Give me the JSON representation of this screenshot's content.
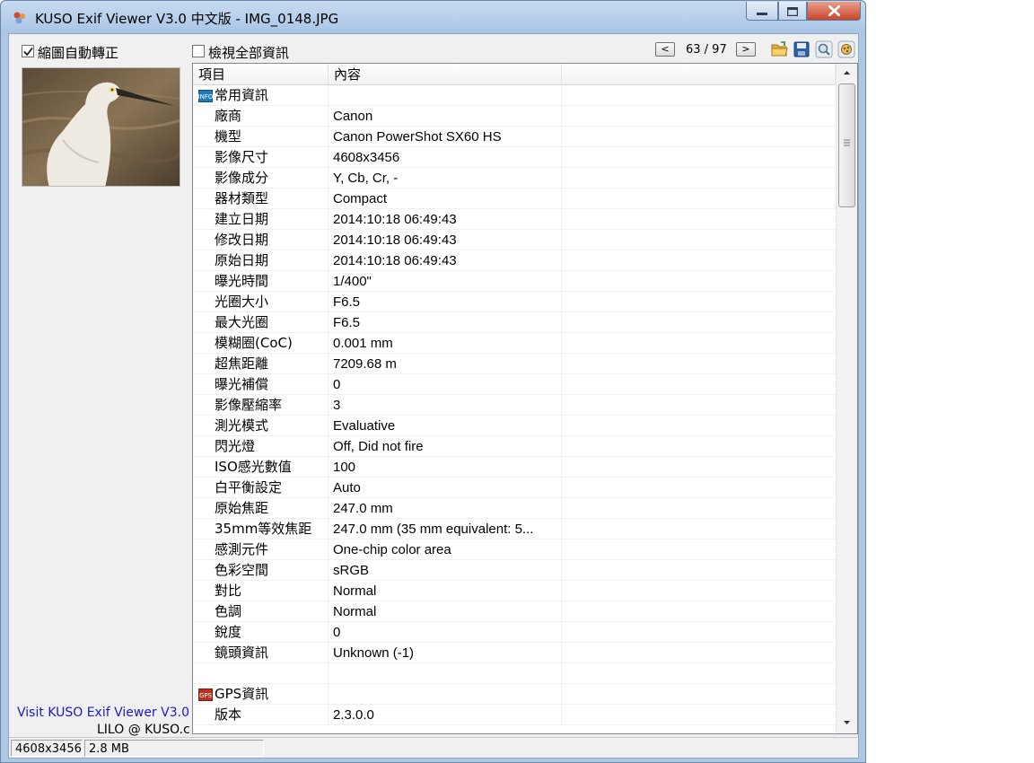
{
  "window": {
    "title": "KUSO Exif Viewer V3.0 中文版 - IMG_0148.JPG"
  },
  "options": {
    "auto_rotate_label": "縮圖自動轉正",
    "auto_rotate_checked": true,
    "view_all_label": "檢視全部資訊",
    "view_all_checked": false
  },
  "nav": {
    "prev_label": "<",
    "next_label": ">",
    "counter": "63 / 97"
  },
  "footer": {
    "visit_link": "Visit KUSO Exif Viewer V3.0",
    "author": "LILO @ KUSO.c"
  },
  "list": {
    "headers": [
      "項目",
      "內容"
    ],
    "rows": [
      {
        "type": "group",
        "icon": "info-icon",
        "name": "常用資訊",
        "value": ""
      },
      {
        "type": "item",
        "name": "廠商",
        "value": "Canon"
      },
      {
        "type": "item",
        "name": "機型",
        "value": "Canon PowerShot SX60 HS"
      },
      {
        "type": "item",
        "name": "影像尺寸",
        "value": "4608x3456"
      },
      {
        "type": "item",
        "name": "影像成分",
        "value": "Y, Cb, Cr, -"
      },
      {
        "type": "item",
        "name": "器材類型",
        "value": "Compact"
      },
      {
        "type": "item",
        "name": "建立日期",
        "value": "2014:10:18 06:49:43"
      },
      {
        "type": "item",
        "name": "修改日期",
        "value": "2014:10:18 06:49:43"
      },
      {
        "type": "item",
        "name": "原始日期",
        "value": "2014:10:18 06:49:43"
      },
      {
        "type": "item",
        "name": "曝光時間",
        "value": "1/400\""
      },
      {
        "type": "item",
        "name": "光圈大小",
        "value": "F6.5"
      },
      {
        "type": "item",
        "name": "最大光圈",
        "value": "F6.5"
      },
      {
        "type": "item",
        "name": "模糊圈(CoC)",
        "value": "0.001 mm"
      },
      {
        "type": "item",
        "name": "超焦距離",
        "value": "7209.68 m"
      },
      {
        "type": "item",
        "name": "曝光補償",
        "value": "0"
      },
      {
        "type": "item",
        "name": "影像壓縮率",
        "value": "3"
      },
      {
        "type": "item",
        "name": "測光模式",
        "value": "Evaluative"
      },
      {
        "type": "item",
        "name": "閃光燈",
        "value": "Off, Did not fire"
      },
      {
        "type": "item",
        "name": "ISO感光數值",
        "value": "100"
      },
      {
        "type": "item",
        "name": "白平衡設定",
        "value": "Auto"
      },
      {
        "type": "item",
        "name": "原始焦距",
        "value": "247.0 mm"
      },
      {
        "type": "item",
        "name": "35mm等效焦距",
        "value": "247.0 mm (35 mm equivalent: 5..."
      },
      {
        "type": "item",
        "name": "感測元件",
        "value": "One-chip color area"
      },
      {
        "type": "item",
        "name": "色彩空間",
        "value": "sRGB"
      },
      {
        "type": "item",
        "name": "對比",
        "value": "Normal"
      },
      {
        "type": "item",
        "name": "色調",
        "value": "Normal"
      },
      {
        "type": "item",
        "name": "銳度",
        "value": "0"
      },
      {
        "type": "item",
        "name": "鏡頭資訊",
        "value": "Unknown (-1)"
      },
      {
        "type": "blank",
        "name": "",
        "value": ""
      },
      {
        "type": "group",
        "icon": "gps-icon",
        "name": "GPS資訊",
        "value": ""
      },
      {
        "type": "item",
        "name": "版本",
        "value": "2.3.0.0"
      }
    ]
  },
  "status": {
    "dimensions": "4608x3456",
    "filesize": "2.8 MB"
  },
  "toolbar_icons": [
    "open-folder-icon",
    "save-icon",
    "search-icon",
    "settings-icon"
  ],
  "colors": {
    "titlebar": "#aec7e4",
    "close_button": "#c8452a",
    "link": "#1a1acc"
  }
}
